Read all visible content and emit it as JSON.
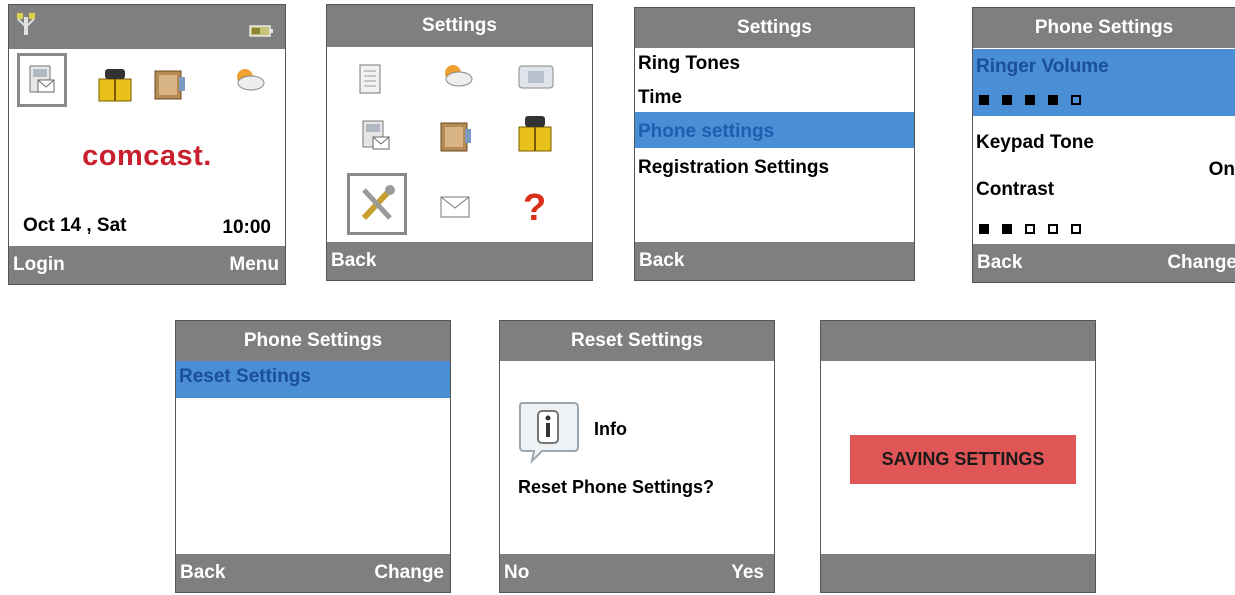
{
  "screens": {
    "home": {
      "date": "Oct 14 , Sat",
      "time": "10:00",
      "logo": "comcast.",
      "softkey_left": "Login",
      "softkey_right": "Menu",
      "icons": [
        "signal-antenna-icon",
        "battery-icon",
        "contacts-card-icon",
        "phone-book-icon",
        "notebook-icon",
        "weather-icon"
      ]
    },
    "menu": {
      "title": "Settings",
      "softkey_left": "Back",
      "icons": [
        "notepad-icon",
        "weather-icon",
        "media-icon",
        "contacts-card-icon",
        "notebook-icon",
        "phone-book-icon",
        "settings-tools-icon",
        "envelope-icon",
        "help-icon"
      ]
    },
    "settings": {
      "title": "Settings",
      "items": [
        "Ring Tones",
        "Time",
        "Phone settings",
        "Registration Settings"
      ],
      "selected_index": 2,
      "softkey_left": "Back"
    },
    "phone_settings": {
      "title": "Phone Settings",
      "ringer_label": "Ringer Volume",
      "ringer_level": 4,
      "ringer_max": 5,
      "keypad_label": "Keypad Tone",
      "keypad_value": "On",
      "contrast_label": "Contrast",
      "contrast_level": 2,
      "contrast_max": 5,
      "softkey_left": "Back",
      "softkey_right": "Change"
    },
    "phone_settings_reset": {
      "title": "Phone Settings",
      "item": "Reset Settings",
      "softkey_left": "Back",
      "softkey_right": "Change"
    },
    "reset_confirm": {
      "title": "Reset Settings",
      "info_label": "Info",
      "question": "Reset Phone Settings?",
      "softkey_left": "No",
      "softkey_right": "Yes"
    },
    "saving": {
      "message": "SAVING SETTINGS"
    }
  },
  "colors": {
    "bar": "#7f7f7f",
    "highlight": "#4a8ed6",
    "saving_banner": "#e05555",
    "comcast_red": "#c8202e"
  }
}
